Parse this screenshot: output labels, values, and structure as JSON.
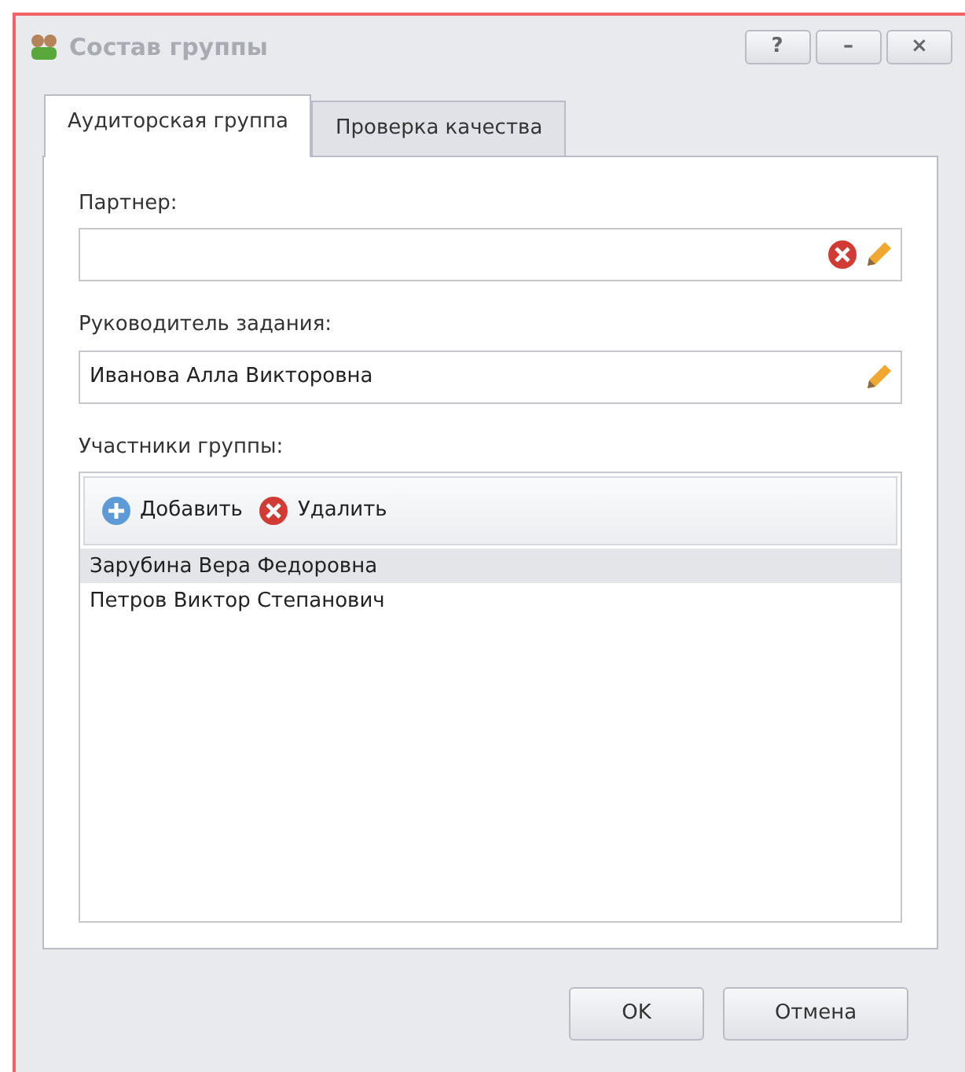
{
  "window": {
    "title": "Состав группы",
    "title_buttons": [
      "?",
      "–",
      "×"
    ]
  },
  "tabs": [
    {
      "label": "Аудиторская группа",
      "selected": true
    },
    {
      "label": "Проверка качества",
      "selected": false
    }
  ],
  "fields": [
    {
      "label": "Партнер:",
      "clearable": true
    },
    {
      "label": "Руководитель задания:",
      "value": "Иванова Алла Викторовна",
      "clearable": false
    }
  ],
  "members": {
    "label": "Участники группы:",
    "toolbar": [
      {
        "kind": "add",
        "label": "Добавить"
      },
      {
        "kind": "remove",
        "label": "Удалить"
      }
    ],
    "rows": [
      {
        "name": "Зарубина Вера Федоровна",
        "selected": true
      },
      {
        "name": "Петров Виктор Степанович",
        "selected": false
      }
    ]
  },
  "buttons": [
    "OK",
    "Отмена"
  ]
}
